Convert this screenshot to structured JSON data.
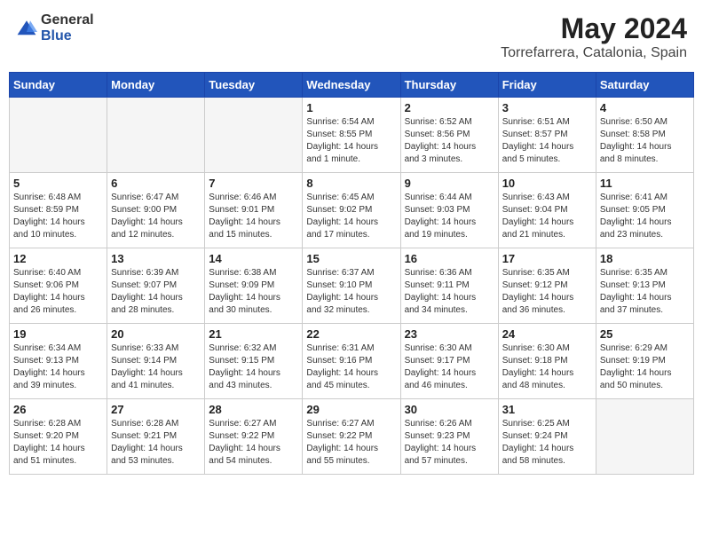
{
  "header": {
    "logo_general": "General",
    "logo_blue": "Blue",
    "month_title": "May 2024",
    "location": "Torrefarrera, Catalonia, Spain"
  },
  "weekdays": [
    "Sunday",
    "Monday",
    "Tuesday",
    "Wednesday",
    "Thursday",
    "Friday",
    "Saturday"
  ],
  "weeks": [
    [
      {
        "day": "",
        "info": ""
      },
      {
        "day": "",
        "info": ""
      },
      {
        "day": "",
        "info": ""
      },
      {
        "day": "1",
        "info": "Sunrise: 6:54 AM\nSunset: 8:55 PM\nDaylight: 14 hours\nand 1 minute."
      },
      {
        "day": "2",
        "info": "Sunrise: 6:52 AM\nSunset: 8:56 PM\nDaylight: 14 hours\nand 3 minutes."
      },
      {
        "day": "3",
        "info": "Sunrise: 6:51 AM\nSunset: 8:57 PM\nDaylight: 14 hours\nand 5 minutes."
      },
      {
        "day": "4",
        "info": "Sunrise: 6:50 AM\nSunset: 8:58 PM\nDaylight: 14 hours\nand 8 minutes."
      }
    ],
    [
      {
        "day": "5",
        "info": "Sunrise: 6:48 AM\nSunset: 8:59 PM\nDaylight: 14 hours\nand 10 minutes."
      },
      {
        "day": "6",
        "info": "Sunrise: 6:47 AM\nSunset: 9:00 PM\nDaylight: 14 hours\nand 12 minutes."
      },
      {
        "day": "7",
        "info": "Sunrise: 6:46 AM\nSunset: 9:01 PM\nDaylight: 14 hours\nand 15 minutes."
      },
      {
        "day": "8",
        "info": "Sunrise: 6:45 AM\nSunset: 9:02 PM\nDaylight: 14 hours\nand 17 minutes."
      },
      {
        "day": "9",
        "info": "Sunrise: 6:44 AM\nSunset: 9:03 PM\nDaylight: 14 hours\nand 19 minutes."
      },
      {
        "day": "10",
        "info": "Sunrise: 6:43 AM\nSunset: 9:04 PM\nDaylight: 14 hours\nand 21 minutes."
      },
      {
        "day": "11",
        "info": "Sunrise: 6:41 AM\nSunset: 9:05 PM\nDaylight: 14 hours\nand 23 minutes."
      }
    ],
    [
      {
        "day": "12",
        "info": "Sunrise: 6:40 AM\nSunset: 9:06 PM\nDaylight: 14 hours\nand 26 minutes."
      },
      {
        "day": "13",
        "info": "Sunrise: 6:39 AM\nSunset: 9:07 PM\nDaylight: 14 hours\nand 28 minutes."
      },
      {
        "day": "14",
        "info": "Sunrise: 6:38 AM\nSunset: 9:09 PM\nDaylight: 14 hours\nand 30 minutes."
      },
      {
        "day": "15",
        "info": "Sunrise: 6:37 AM\nSunset: 9:10 PM\nDaylight: 14 hours\nand 32 minutes."
      },
      {
        "day": "16",
        "info": "Sunrise: 6:36 AM\nSunset: 9:11 PM\nDaylight: 14 hours\nand 34 minutes."
      },
      {
        "day": "17",
        "info": "Sunrise: 6:35 AM\nSunset: 9:12 PM\nDaylight: 14 hours\nand 36 minutes."
      },
      {
        "day": "18",
        "info": "Sunrise: 6:35 AM\nSunset: 9:13 PM\nDaylight: 14 hours\nand 37 minutes."
      }
    ],
    [
      {
        "day": "19",
        "info": "Sunrise: 6:34 AM\nSunset: 9:13 PM\nDaylight: 14 hours\nand 39 minutes."
      },
      {
        "day": "20",
        "info": "Sunrise: 6:33 AM\nSunset: 9:14 PM\nDaylight: 14 hours\nand 41 minutes."
      },
      {
        "day": "21",
        "info": "Sunrise: 6:32 AM\nSunset: 9:15 PM\nDaylight: 14 hours\nand 43 minutes."
      },
      {
        "day": "22",
        "info": "Sunrise: 6:31 AM\nSunset: 9:16 PM\nDaylight: 14 hours\nand 45 minutes."
      },
      {
        "day": "23",
        "info": "Sunrise: 6:30 AM\nSunset: 9:17 PM\nDaylight: 14 hours\nand 46 minutes."
      },
      {
        "day": "24",
        "info": "Sunrise: 6:30 AM\nSunset: 9:18 PM\nDaylight: 14 hours\nand 48 minutes."
      },
      {
        "day": "25",
        "info": "Sunrise: 6:29 AM\nSunset: 9:19 PM\nDaylight: 14 hours\nand 50 minutes."
      }
    ],
    [
      {
        "day": "26",
        "info": "Sunrise: 6:28 AM\nSunset: 9:20 PM\nDaylight: 14 hours\nand 51 minutes."
      },
      {
        "day": "27",
        "info": "Sunrise: 6:28 AM\nSunset: 9:21 PM\nDaylight: 14 hours\nand 53 minutes."
      },
      {
        "day": "28",
        "info": "Sunrise: 6:27 AM\nSunset: 9:22 PM\nDaylight: 14 hours\nand 54 minutes."
      },
      {
        "day": "29",
        "info": "Sunrise: 6:27 AM\nSunset: 9:22 PM\nDaylight: 14 hours\nand 55 minutes."
      },
      {
        "day": "30",
        "info": "Sunrise: 6:26 AM\nSunset: 9:23 PM\nDaylight: 14 hours\nand 57 minutes."
      },
      {
        "day": "31",
        "info": "Sunrise: 6:25 AM\nSunset: 9:24 PM\nDaylight: 14 hours\nand 58 minutes."
      },
      {
        "day": "",
        "info": ""
      }
    ]
  ]
}
